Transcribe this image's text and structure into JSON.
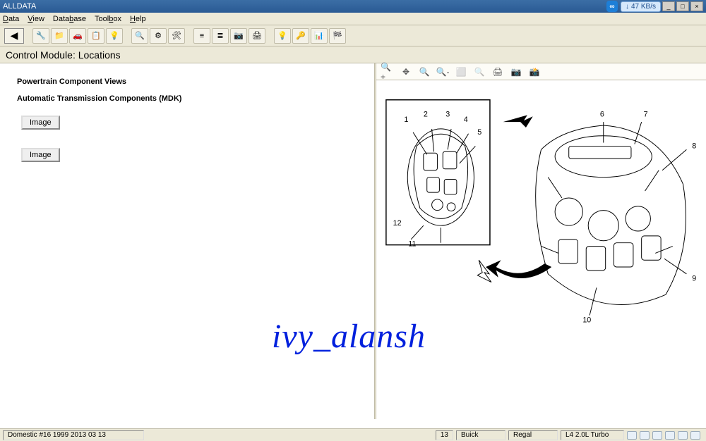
{
  "app": {
    "title": "ALLDATA"
  },
  "menu": {
    "data": "Data",
    "view": "View",
    "database": "Database",
    "toolbox": "Toolbox",
    "help": "Help"
  },
  "speed": {
    "label": "47 KB/s",
    "arrow": "↓"
  },
  "breadcrumb": {
    "text": "Control Module:  Locations"
  },
  "left": {
    "h1": "Powertrain Component Views",
    "h2": "Automatic Transmission Components (MDK)",
    "imageBtn": "Image"
  },
  "callouts": {
    "small": [
      "1",
      "2",
      "3",
      "4",
      "5",
      "11",
      "12"
    ],
    "large": [
      "6",
      "7",
      "8",
      "9",
      "10"
    ]
  },
  "status": {
    "cell1": "Domestic #16 1999 2013 03 13",
    "cell2": "13",
    "cell3": "Buick",
    "cell4": "Regal",
    "cell5": "L4 2.0L Turbo"
  },
  "watermark": "ivy_alansh"
}
